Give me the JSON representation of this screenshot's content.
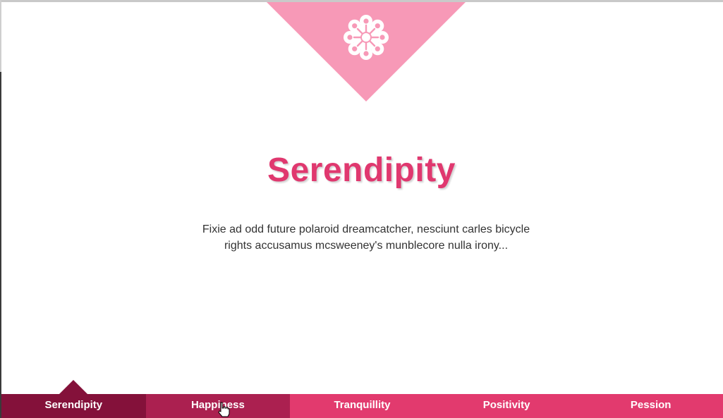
{
  "hero": {
    "icon": "flower-icon",
    "title": "Serendipity",
    "description_line1": "Fixie ad odd future polaroid dreamcatcher, nesciunt carles bicycle",
    "description_line2": "rights accusamus mcsweeney's munblecore nulla irony..."
  },
  "tabs": [
    {
      "label": "Serendipity",
      "active": true,
      "color": "#84113a"
    },
    {
      "label": "Happiness",
      "active": false,
      "color": "#ab2050"
    },
    {
      "label": "Tranquillity",
      "active": false,
      "color": "#e23a6e"
    },
    {
      "label": "Positivity",
      "active": false,
      "color": "#e23a6e"
    },
    {
      "label": "Pession",
      "active": false,
      "color": "#e23a6e"
    }
  ],
  "colors": {
    "accent": "#e0386f",
    "banner": "#f799b7",
    "text": "#333333"
  },
  "cursor": "hand-pointer-icon"
}
